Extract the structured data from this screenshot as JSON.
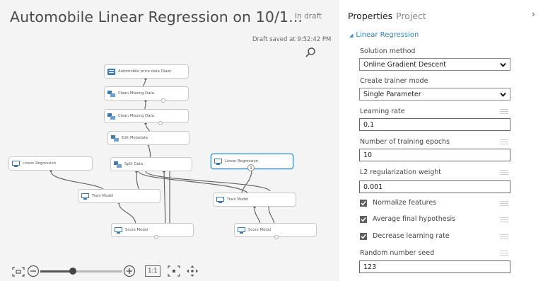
{
  "experiment": {
    "title": "Automobile Linear Regression on 10/1...",
    "status": "In draft",
    "saved_text": "Draft saved at 9:52:42 PM"
  },
  "canvas": {
    "nodes": [
      {
        "id": "raw",
        "label": "Automobile price data (Raw)",
        "icon": "dataset-icon"
      },
      {
        "id": "clean1",
        "label": "Clean Missing Data",
        "icon": "module-icon"
      },
      {
        "id": "clean2",
        "label": "Clean Missing Data",
        "icon": "module-icon"
      },
      {
        "id": "edit",
        "label": "Edit Metadata",
        "icon": "module-icon"
      },
      {
        "id": "lr1",
        "label": "Linear Regression",
        "icon": "model-icon"
      },
      {
        "id": "split",
        "label": "Split Data",
        "icon": "module-icon"
      },
      {
        "id": "lr2",
        "label": "Linear Regression",
        "icon": "model-icon",
        "badge": "1"
      },
      {
        "id": "train1",
        "label": "Train Model",
        "icon": "model-icon"
      },
      {
        "id": "train2",
        "label": "Train Model",
        "icon": "model-icon"
      },
      {
        "id": "score1",
        "label": "Score Model",
        "icon": "model-icon"
      },
      {
        "id": "score2",
        "label": "Score Model",
        "icon": "model-icon"
      }
    ],
    "toolbar": {
      "zoom_level": 0.4,
      "actual_size_label": "1:1"
    }
  },
  "panel": {
    "tabs": {
      "properties": "Properties",
      "project": "Project"
    },
    "section_title": "Linear Regression",
    "solution_method": {
      "label": "Solution method",
      "value": "Online Gradient Descent"
    },
    "trainer_mode": {
      "label": "Create trainer mode",
      "value": "Single Parameter"
    },
    "learning_rate": {
      "label": "Learning rate",
      "value": "0.1"
    },
    "epochs": {
      "label": "Number of training epochs",
      "value": "10"
    },
    "l2": {
      "label": "L2 regularization weight",
      "value": "0.001"
    },
    "normalize": {
      "label": "Normalize features",
      "checked": true
    },
    "average": {
      "label": "Average final hypothesis",
      "checked": true
    },
    "decrease": {
      "label": "Decrease learning rate",
      "checked": true
    },
    "seed": {
      "label": "Random number seed",
      "value": "123"
    }
  },
  "colors": {
    "accent": "#2e86c8",
    "canvas_bg": "#f4f4f4",
    "checkbox": "#606060"
  }
}
